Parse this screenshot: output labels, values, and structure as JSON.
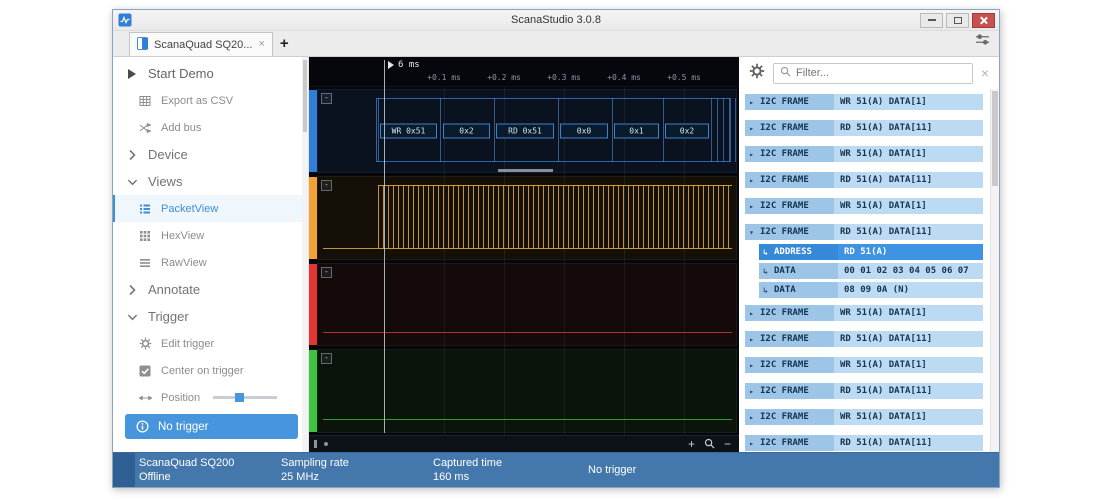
{
  "window": {
    "title": "ScanaStudio 3.0.8"
  },
  "tabbar": {
    "tab_label": "ScanaQuad SQ20...",
    "tab_close": "×",
    "add_label": "+"
  },
  "sidebar": {
    "items": [
      {
        "id": "start-demo",
        "kind": "top",
        "icon": "play",
        "label": "Start Demo"
      },
      {
        "id": "export-csv",
        "kind": "sub",
        "icon": "table",
        "label": "Export as CSV"
      },
      {
        "id": "add-bus",
        "kind": "sub",
        "icon": "shuffle",
        "label": "Add bus"
      },
      {
        "id": "device",
        "kind": "section",
        "collapsed": true,
        "label": "Device"
      },
      {
        "id": "views",
        "kind": "section",
        "collapsed": false,
        "label": "Views"
      },
      {
        "id": "packetview",
        "kind": "sub",
        "icon": "list",
        "label": "PacketView",
        "selected": true
      },
      {
        "id": "hexview",
        "kind": "sub",
        "icon": "grid",
        "label": "HexView"
      },
      {
        "id": "rawview",
        "kind": "sub",
        "icon": "rows",
        "label": "RawView"
      },
      {
        "id": "annotate",
        "kind": "section",
        "collapsed": true,
        "label": "Annotate"
      },
      {
        "id": "trigger",
        "kind": "section",
        "collapsed": false,
        "label": "Trigger"
      },
      {
        "id": "edit-trigger",
        "kind": "sub",
        "icon": "gear",
        "label": "Edit trigger"
      },
      {
        "id": "center-on-trigger",
        "kind": "sub",
        "icon": "checkbox",
        "label": "Center on trigger"
      },
      {
        "id": "position",
        "kind": "slider",
        "icon": "arrows",
        "label": "Position"
      },
      {
        "id": "no-trigger",
        "kind": "button",
        "icon": "info",
        "label": "No trigger"
      }
    ]
  },
  "waveform": {
    "cursor_label": "6 ms",
    "ticks": [
      "+0.1 ms",
      "+0.2 ms",
      "+0.3 ms",
      "+0.4 ms",
      "+0.5 ms"
    ],
    "decoded": [
      "WR 0x51",
      "0x2",
      "RD 0x51",
      "0x0",
      "0x1",
      "0x2"
    ],
    "collapse_glyph": "-",
    "zoom_in": "+",
    "zoom_out": "−",
    "channels": [
      {
        "id": "channel-1",
        "color": "#2f7fd6"
      },
      {
        "id": "channel-2",
        "color": "#f0a236"
      },
      {
        "id": "channel-3",
        "color": "#e23535"
      },
      {
        "id": "channel-4",
        "color": "#3ec43e"
      }
    ]
  },
  "packet_panel": {
    "filter_placeholder": "Filter...",
    "close_glyph": "×",
    "rows": [
      {
        "kind": "frame",
        "label": "I2C FRAME",
        "value": "WR 51(A) DATA[1]"
      },
      {
        "kind": "frame",
        "label": "I2C FRAME",
        "value": "RD 51(A) DATA[11]"
      },
      {
        "kind": "frame",
        "label": "I2C FRAME",
        "value": "WR 51(A) DATA[1]"
      },
      {
        "kind": "frame",
        "label": "I2C FRAME",
        "value": "RD 51(A) DATA[11]"
      },
      {
        "kind": "frame",
        "label": "I2C FRAME",
        "value": "WR 51(A) DATA[1]"
      },
      {
        "kind": "frame",
        "label": "I2C FRAME",
        "value": "RD 51(A) DATA[11]",
        "expanded": true
      },
      {
        "kind": "sub",
        "label": "ADDRESS",
        "value": "RD 51(A)",
        "selected": true
      },
      {
        "kind": "sub",
        "label": "DATA",
        "value": "00 01 02 03 04 05 06 07"
      },
      {
        "kind": "sub",
        "label": "DATA",
        "value": "08 09 0A (N)"
      },
      {
        "kind": "frame",
        "label": "I2C FRAME",
        "value": "WR 51(A) DATA[1]"
      },
      {
        "kind": "frame",
        "label": "I2C FRAME",
        "value": "RD 51(A) DATA[11]"
      },
      {
        "kind": "frame",
        "label": "I2C FRAME",
        "value": "WR 51(A) DATA[1]"
      },
      {
        "kind": "frame",
        "label": "I2C FRAME",
        "value": "RD 51(A) DATA[11]"
      },
      {
        "kind": "frame",
        "label": "I2C FRAME",
        "value": "WR 51(A) DATA[1]"
      },
      {
        "kind": "frame",
        "label": "I2C FRAME",
        "value": "RD 51(A) DATA[11]"
      }
    ]
  },
  "statusbar": {
    "device_name": "ScanaQuad SQ200",
    "device_state": "Offline",
    "sampling_label": "Sampling rate",
    "sampling_value": "25 MHz",
    "captured_label": "Captured time",
    "captured_value": "160 ms",
    "trigger_label": "No trigger"
  }
}
